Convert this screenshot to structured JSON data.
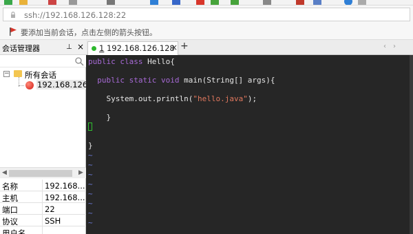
{
  "address": {
    "url": "ssh://192.168.126.128:22"
  },
  "hint": {
    "text": "要添加当前会话，点击左侧的箭头按钮。"
  },
  "session_manager": {
    "title": "会话管理器",
    "pin_glyph": "⊥",
    "close_glyph": "×",
    "tree": {
      "toggle": "−",
      "root_label": "所有会话",
      "child_label": "192.168.126."
    },
    "properties": [
      {
        "key": "名称",
        "value": "192.168...."
      },
      {
        "key": "主机",
        "value": "192.168...."
      },
      {
        "key": "端口",
        "value": "22"
      },
      {
        "key": "协议",
        "value": "SSH"
      },
      {
        "key": "用户名",
        "value": ""
      }
    ]
  },
  "tabs": {
    "active": {
      "number": "1",
      "label": "192.168.126.128"
    },
    "close_glyph": "×",
    "add_glyph": "+",
    "prev_glyph": "‹",
    "next_glyph": "›"
  },
  "terminal": {
    "line1_kw": "public class",
    "line1_rest": " Hello{",
    "line2_kw": "public static void",
    "line2_rest": " main(String[] args){",
    "line3_pre": "System.out.println(",
    "line3_str": "\"hello.java\"",
    "line3_post": ");",
    "line4": "}",
    "line6": "}",
    "tilde": "~"
  },
  "colors": {
    "terminal_bg": "#262626",
    "keyword": "#a76ad6",
    "string": "#e0785e",
    "tilde": "#6b79d6",
    "cursor": "#30c030",
    "tab_status": "#2eb82e"
  }
}
